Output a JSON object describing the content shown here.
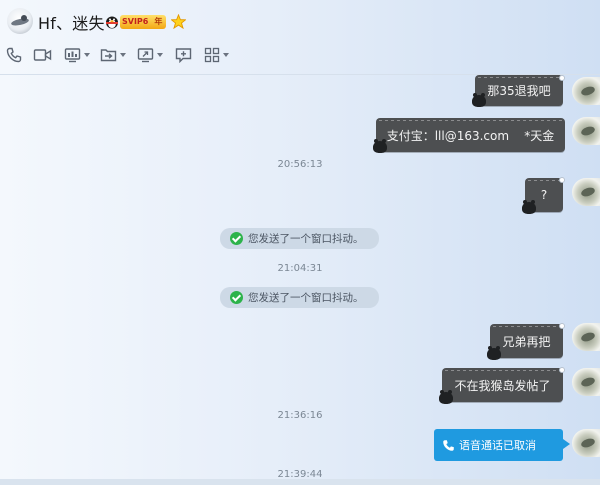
{
  "header": {
    "contact_name": "Hf、迷失",
    "svip_label": "SVIP6",
    "svip_year": "年",
    "penguin_icon": "qq-penguin-icon",
    "star_icon": "star-icon"
  },
  "toolbar": {
    "items": [
      {
        "name": "voice-call-button",
        "icon": "phone-icon"
      },
      {
        "name": "video-call-button",
        "icon": "video-camera-icon"
      },
      {
        "name": "remote-desktop-button",
        "icon": "remote-assist-icon",
        "dropdown": true
      },
      {
        "name": "send-file-button",
        "icon": "file-transfer-icon",
        "dropdown": true
      },
      {
        "name": "screen-share-button",
        "icon": "screen-share-icon",
        "dropdown": true
      },
      {
        "name": "create-group-button",
        "icon": "add-chat-icon"
      },
      {
        "name": "app-grid-button",
        "icon": "app-grid-icon",
        "dropdown": true
      }
    ]
  },
  "messages": {
    "m1": "那35退我吧",
    "m2": "支付宝：lll@163.com    *天金",
    "t1": "20:56:13",
    "m3": "?",
    "sys1": "您发送了一个窗口抖动。",
    "t2": "21:04:31",
    "sys2": "您发送了一个窗口抖动。",
    "m4": "兄弟再把",
    "m5": "不在我猴岛发帖了",
    "t3": "21:36:16",
    "voice": "语音通话已取消",
    "t4": "21:39:44"
  },
  "colors": {
    "bubble": "#4d4f51",
    "voice_bubble": "#1f9ae0",
    "system_ok": "#2db34b",
    "background": "#e6eef9"
  }
}
